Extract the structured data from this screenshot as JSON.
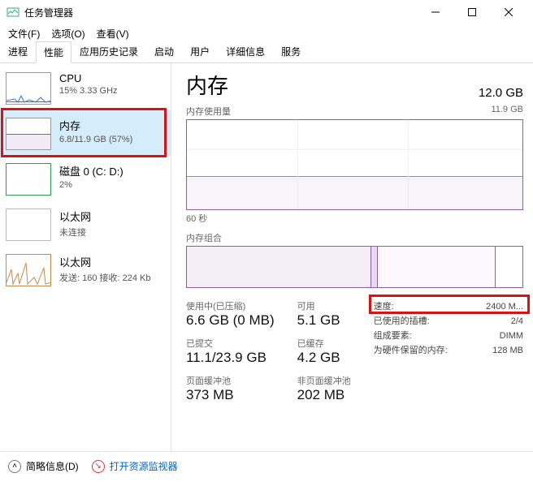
{
  "window": {
    "title": "任务管理器"
  },
  "menu": {
    "file": "文件(F)",
    "options": "选项(O)",
    "view": "查看(V)"
  },
  "tabs": [
    "进程",
    "性能",
    "应用历史记录",
    "启动",
    "用户",
    "详细信息",
    "服务"
  ],
  "sidebar": {
    "items": [
      {
        "title": "CPU",
        "sub": "15% 3.33 GHz"
      },
      {
        "title": "内存",
        "sub": "6.8/11.9 GB (57%)"
      },
      {
        "title": "磁盘 0 (C: D:)",
        "sub": "2%"
      },
      {
        "title": "以太网",
        "sub": "未连接"
      },
      {
        "title": "以太网",
        "sub": "发送: 160 接收: 224 Kb"
      }
    ]
  },
  "main": {
    "title": "内存",
    "total": "12.0 GB",
    "usage_label": "内存使用量",
    "usage_max": "11.9 GB",
    "x_label": "60 秒",
    "comp_label": "内存组合",
    "stats": {
      "in_use_label": "使用中(已压缩)",
      "in_use_value": "6.6 GB (0 MB)",
      "committed_label": "已提交",
      "committed_value": "11.1/23.9 GB",
      "paged_label": "页面缓冲池",
      "paged_value": "373 MB",
      "available_label": "可用",
      "available_value": "5.1 GB",
      "cached_label": "已缓存",
      "cached_value": "4.2 GB",
      "nonpaged_label": "非页面缓冲池",
      "nonpaged_value": "202 MB",
      "speed_label": "速度:",
      "speed_value": "2400 M...",
      "slots_label": "已使用的插槽:",
      "slots_value": "2/4",
      "form_label": "组成要素:",
      "form_value": "DIMM",
      "reserved_label": "为硬件保留的内存:",
      "reserved_value": "128 MB"
    }
  },
  "footer": {
    "summary": "简略信息(D)",
    "resmon": "打开资源监视器"
  },
  "chart_data": {
    "type": "area",
    "title": "内存使用量",
    "ylabel": "GB",
    "ylim": [
      0,
      11.9
    ],
    "x_range_seconds": 60,
    "series": [
      {
        "name": "使用中",
        "approx_value_gb": 6.8
      }
    ],
    "composition_gb": {
      "in_use": 6.6,
      "modified": 0.2,
      "standby": 4.2,
      "free": 0.9,
      "total": 11.9
    }
  }
}
